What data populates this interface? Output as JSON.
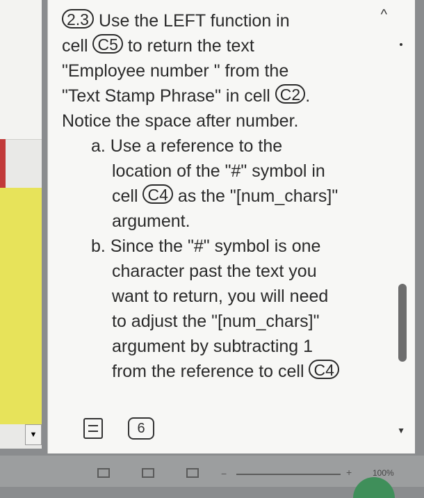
{
  "task": {
    "number": "2.3",
    "line1_after": "Use the LEFT function in",
    "line2_before": "cell",
    "cell_target": "C5",
    "line2_after": "to return the text",
    "line3": "\"Employee number \" from the",
    "line4_before": "\"Text Stamp Phrase\" in cell",
    "cell_source": "C2",
    "line4_after": ".",
    "line5": "Notice the space after number.",
    "sub_a": {
      "line1": "a. Use a reference to the",
      "line2": "location of the \"#\" symbol in",
      "line3_before": "cell",
      "cell": "C4",
      "line3_after": "as the \"[num_chars]\"",
      "line4": "argument."
    },
    "sub_b": {
      "line1": "b. Since the \"#\" symbol is one",
      "line2": "character past the text you",
      "line3": "want to return, you will need",
      "line4": "to adjust the \"[num_chars]\"",
      "line5": "argument by subtracting 1",
      "line6_before": "from the reference to cell",
      "cell": "C4"
    }
  },
  "footer": {
    "page_number": "6"
  },
  "status": {
    "zoom": "100%"
  },
  "icons": {
    "collapse": "chevron-up-icon",
    "instructions": "document-icon",
    "scroll_down": "triangle-down-icon"
  }
}
